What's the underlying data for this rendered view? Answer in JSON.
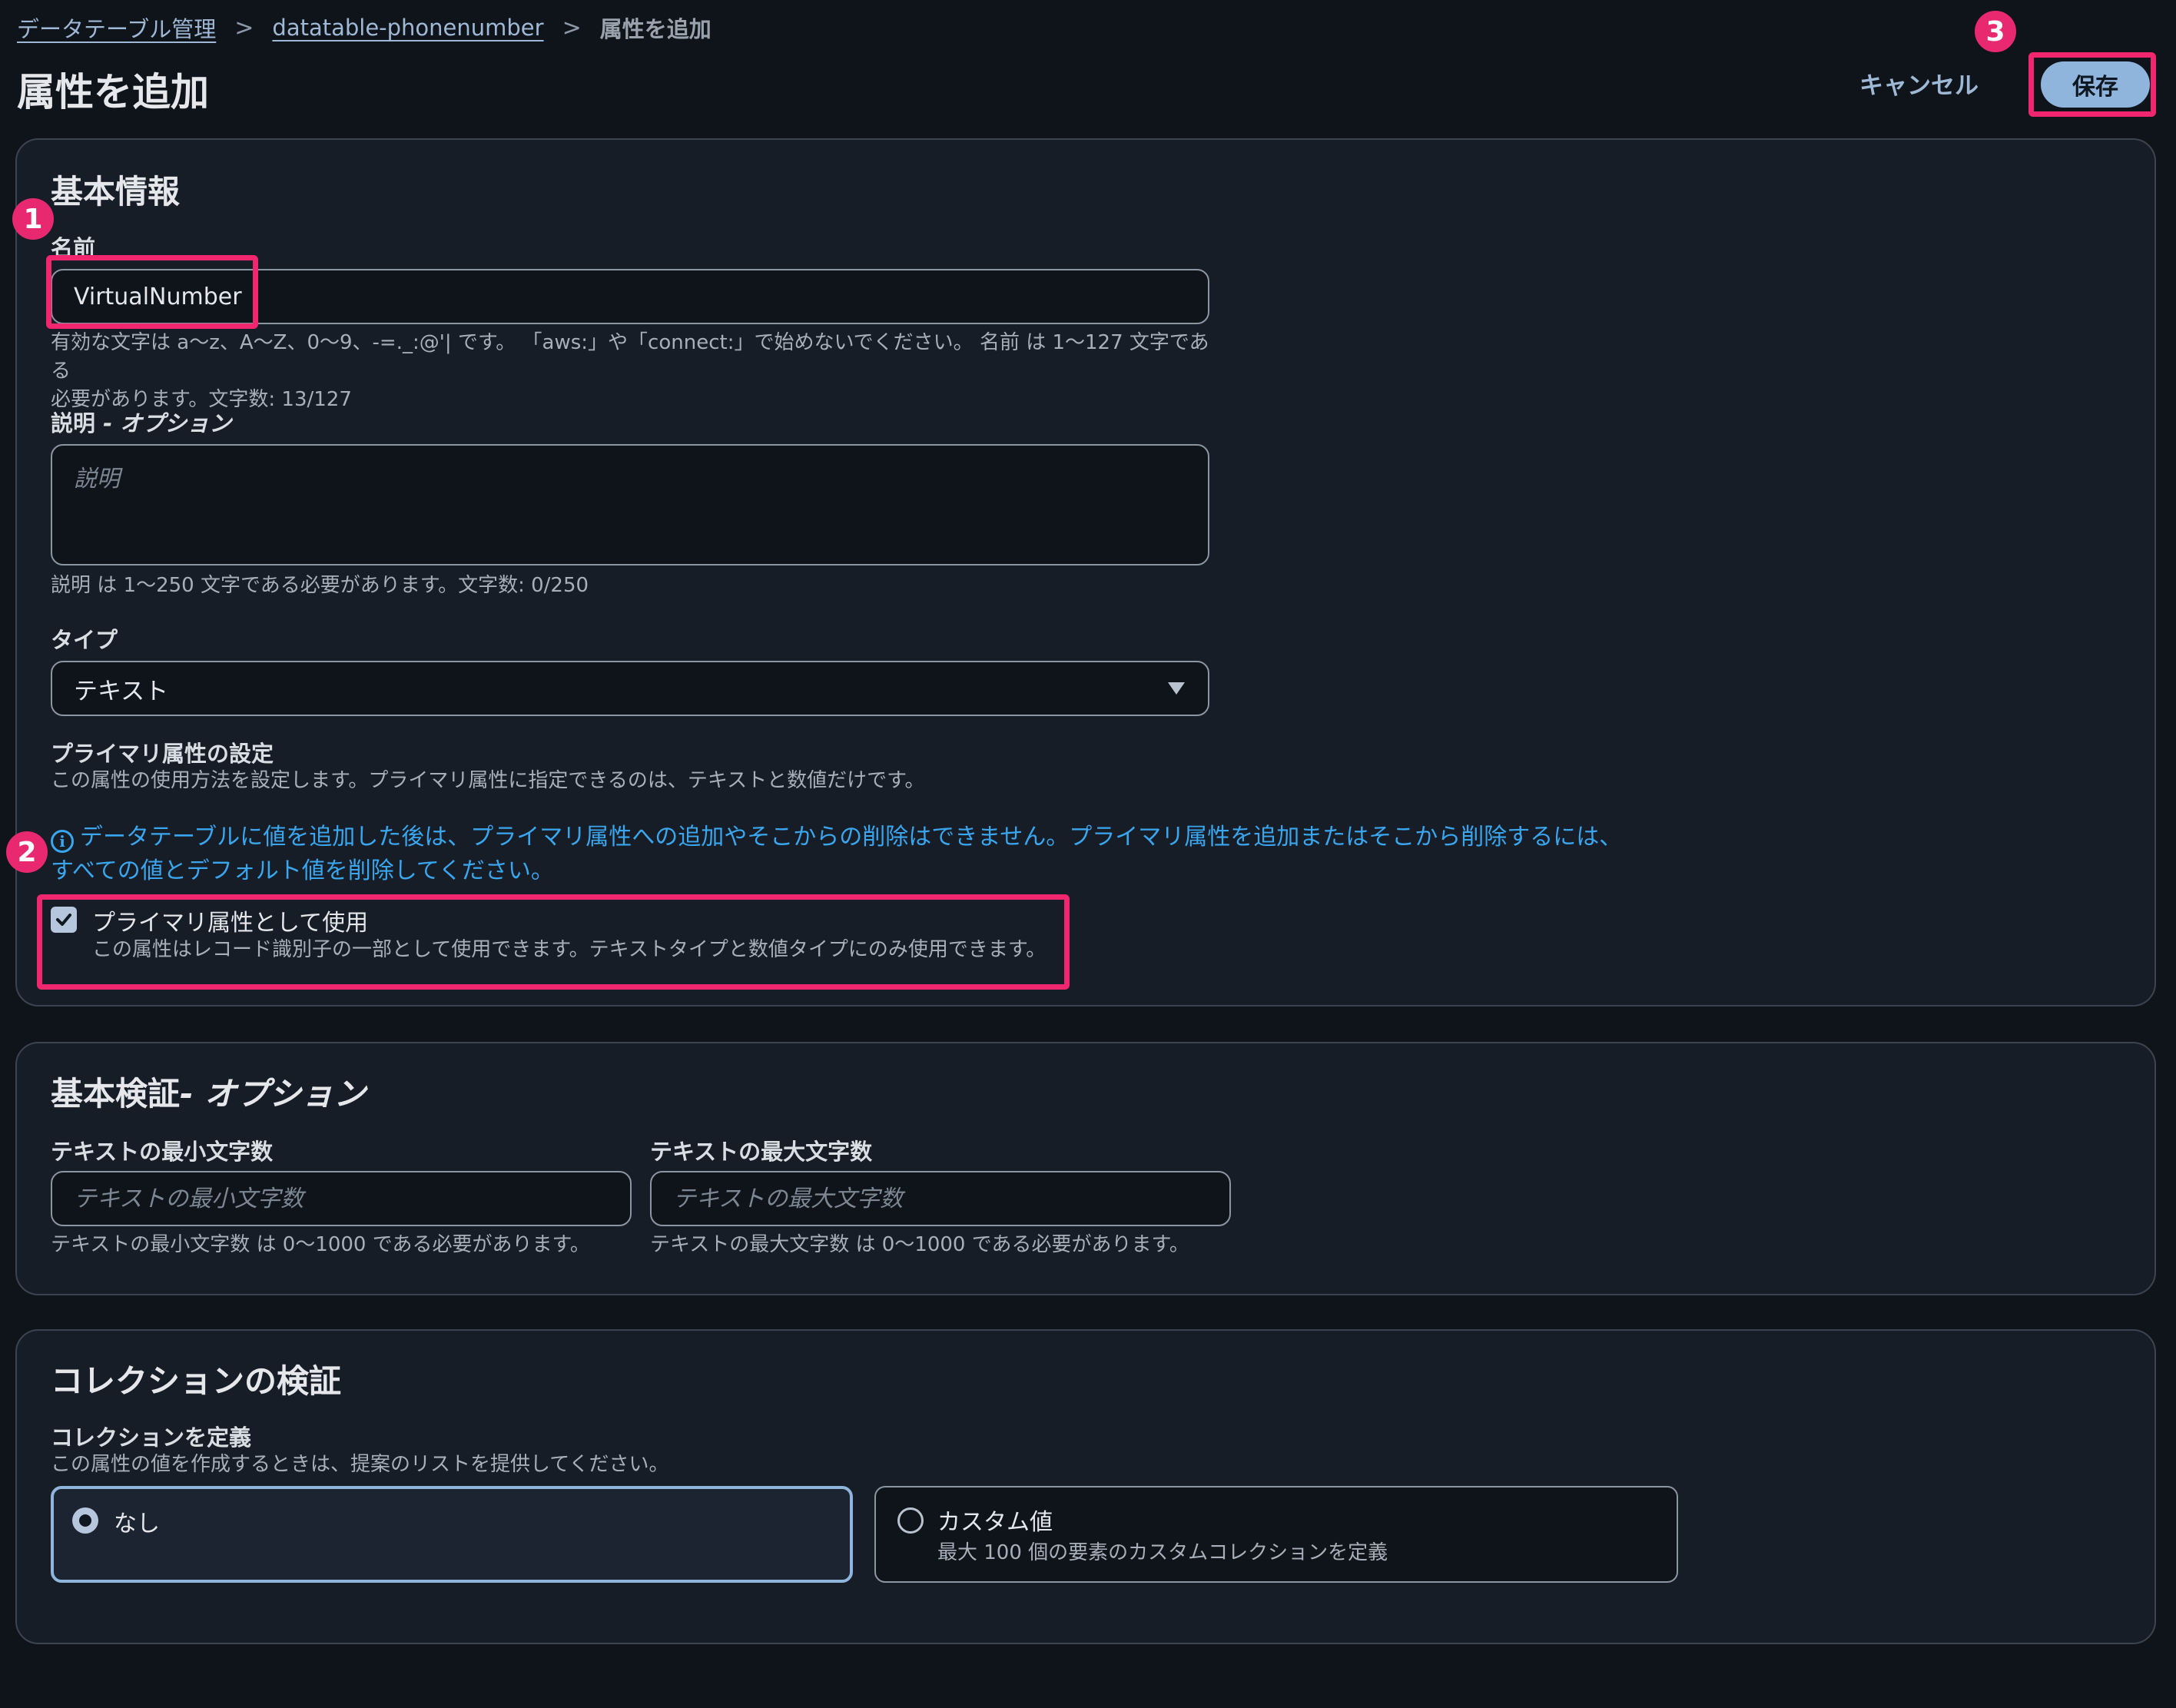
{
  "breadcrumb": {
    "items": [
      {
        "label": "データテーブル管理"
      },
      {
        "label": "datatable-phonenumber"
      },
      {
        "label": "属性を追加"
      }
    ],
    "separator": ">"
  },
  "page": {
    "title": "属性を追加",
    "cancel_label": "キャンセル",
    "save_label": "保存"
  },
  "annotations": {
    "badge1": "1",
    "badge2": "2",
    "badge3": "3",
    "color": "#f0266e"
  },
  "basic_info": {
    "heading": "基本情報",
    "name_label": "名前",
    "name_value": "VirtualNumber",
    "name_hint_1": "有効な文字は a〜z、A〜Z、0〜9、-=._:@'| です。 「aws:」や「connect:」で始めないでください。 名前 は 1〜127 文字である",
    "name_hint_2": "必要があります。文字数: 13/127",
    "description_label": "説明",
    "description_optional": "- オプション",
    "description_placeholder": "説明",
    "description_hint": "説明 は 1〜250 文字である必要があります。文字数: 0/250",
    "type_label": "タイプ",
    "type_value": "テキスト",
    "primary_heading": "プライマリ属性の設定",
    "primary_desc": "この属性の使用方法を設定します。プライマリ属性に指定できるのは、テキストと数値だけです。",
    "info_line1": "データテーブルに値を追加した後は、プライマリ属性への追加やそこからの削除はできません。プライマリ属性を追加またはそこから削除するには、",
    "info_line2": "すべての値とデフォルト値を削除してください。",
    "primary_checkbox_label": "プライマリ属性として使用",
    "primary_checkbox_checked": true,
    "primary_checkbox_desc": "この属性はレコード識別子の一部として使用できます。テキストタイプと数値タイプにのみ使用できます。"
  },
  "validation": {
    "heading": "基本検証",
    "heading_optional": "- オプション",
    "min_label": "テキストの最小文字数",
    "min_placeholder": "テキストの最小文字数",
    "min_hint": "テキストの最小文字数 は 0〜1000 である必要があります。",
    "max_label": "テキストの最大文字数",
    "max_placeholder": "テキストの最大文字数",
    "max_hint": "テキストの最大文字数 は 0〜1000 である必要があります。"
  },
  "collection": {
    "heading": "コレクションの検証",
    "define_label": "コレクションを定義",
    "define_desc": "この属性の値を作成するときは、提案のリストを提供してください。",
    "options": [
      {
        "label": "なし",
        "desc": "",
        "selected": true
      },
      {
        "label": "カスタム値",
        "desc": "最大 100 個の要素のカスタムコレクションを定義",
        "selected": false
      }
    ]
  },
  "colors": {
    "accent": "#8fb5dc",
    "info": "#3aa6ef",
    "highlight": "#f0266e",
    "background": "#0f141a",
    "panel": "#161d26"
  }
}
